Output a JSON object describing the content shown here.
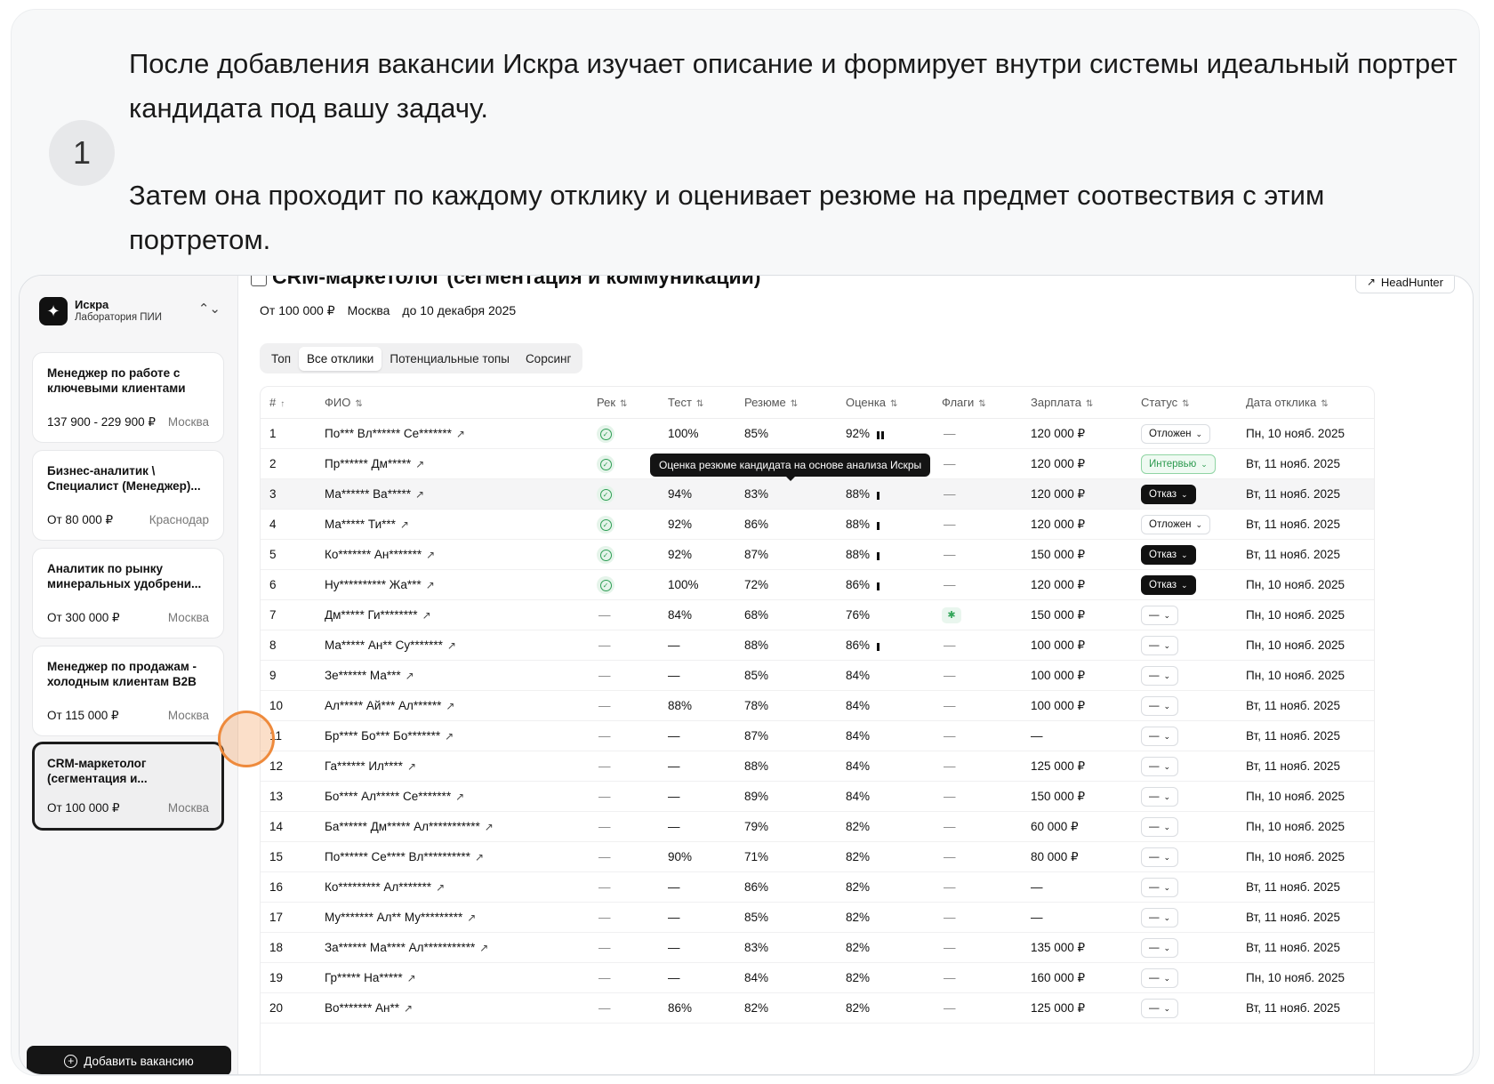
{
  "step": {
    "number": "1",
    "paragraphs": [
      "После добавления вакансии Искра изучает описание и формирует внутри системы идеальный портрет кандидата под вашу задачу.",
      "Затем она проходит по каждому отклику и оценивает резюме на предмет соотвествия с этим портретом."
    ]
  },
  "sidebar": {
    "org": {
      "name": "Искра",
      "subtitle": "Лаборатория ПИИ",
      "logo_icon": "sparkle-icon",
      "toggle_icon": "chevron-updown-icon"
    },
    "vacancies": [
      {
        "title": "Менеджер по работе с ключевыми клиентами",
        "salary": "137 900 - 229 900 ₽",
        "city": "Москва",
        "active": false
      },
      {
        "title": "Бизнес-аналитик \\ Специалист (Менеджер)...",
        "salary": "От 80 000 ₽",
        "city": "Краснодар",
        "active": false
      },
      {
        "title": "Аналитик по рынку минеральных удобрени...",
        "salary": "От 300 000 ₽",
        "city": "Москва",
        "active": false
      },
      {
        "title": "Менеджер по продажам - холодным клиентам B2B",
        "salary": "От 115 000 ₽",
        "city": "Москва",
        "active": false
      },
      {
        "title": "CRM-маркетолог (сегментация и...",
        "salary": "От 100 000 ₽",
        "city": "Москва",
        "active": true
      }
    ],
    "add_button": "Добавить вакансию"
  },
  "header": {
    "title": "CRM-маркетолог (сегментация и коммуникации)",
    "source_button": "HeadHunter",
    "salary": "От 100 000 ₽",
    "city": "Москва",
    "deadline": "до 10 декабря 2025"
  },
  "tabs": [
    {
      "label": "Топ",
      "active": false
    },
    {
      "label": "Все отклики",
      "active": true
    },
    {
      "label": "Потенциальные топы",
      "active": false
    },
    {
      "label": "Сорсинг",
      "active": false
    }
  ],
  "table": {
    "columns": [
      "#",
      "ФИО",
      "Рек",
      "Тест",
      "Резюме",
      "Оценка",
      "Флаги",
      "Зарплата",
      "Статус",
      "Дата отклика"
    ],
    "rows": [
      {
        "n": "1",
        "name": "По*** Вл****** Се*******",
        "rec": true,
        "test": "100%",
        "resume": "85%",
        "score": "92%",
        "bars": 2,
        "flag": false,
        "salary": "120 000 ₽",
        "status": "Отложен",
        "status_type": "delay",
        "date": "Пн, 10 нояб. 2025"
      },
      {
        "n": "2",
        "name": "Пр****** Дм*****",
        "rec": true,
        "test": "",
        "resume": "",
        "score": "",
        "bars": 0,
        "flag": false,
        "salary": "120 000 ₽",
        "status": "Интервью",
        "status_type": "interview",
        "date": "Вт, 11 нояб. 2025"
      },
      {
        "n": "3",
        "name": "Ма****** Ва*****",
        "rec": true,
        "test": "94%",
        "resume": "83%",
        "score": "88%",
        "bars": 1,
        "flag": false,
        "salary": "120 000 ₽",
        "status": "Отказ",
        "status_type": "reject",
        "date": "Вт, 11 нояб. 2025",
        "highlight": true
      },
      {
        "n": "4",
        "name": "Ма***** Ти***",
        "rec": true,
        "test": "92%",
        "resume": "86%",
        "score": "88%",
        "bars": 1,
        "flag": false,
        "salary": "120 000 ₽",
        "status": "Отложен",
        "status_type": "delay",
        "date": "Вт, 11 нояб. 2025"
      },
      {
        "n": "5",
        "name": "Ко******* Ан*******",
        "rec": true,
        "test": "92%",
        "resume": "87%",
        "score": "88%",
        "bars": 1,
        "flag": false,
        "salary": "150 000 ₽",
        "status": "Отказ",
        "status_type": "reject",
        "date": "Вт, 11 нояб. 2025"
      },
      {
        "n": "6",
        "name": "Ну********** Жа***",
        "rec": true,
        "test": "100%",
        "resume": "72%",
        "score": "86%",
        "bars": 1,
        "flag": false,
        "salary": "120 000 ₽",
        "status": "Отказ",
        "status_type": "reject",
        "date": "Пн, 10 нояб. 2025"
      },
      {
        "n": "7",
        "name": "Дм***** Ги********",
        "rec": false,
        "test": "84%",
        "resume": "68%",
        "score": "76%",
        "bars": 0,
        "flag": true,
        "salary": "150 000 ₽",
        "status": "—",
        "status_type": "none",
        "date": "Пн, 10 нояб. 2025"
      },
      {
        "n": "8",
        "name": "Ма***** Ан** Су*******",
        "rec": false,
        "test": "—",
        "resume": "88%",
        "score": "86%",
        "bars": 1,
        "flag": false,
        "salary": "100 000 ₽",
        "status": "—",
        "status_type": "none",
        "date": "Пн, 10 нояб. 2025"
      },
      {
        "n": "9",
        "name": "Зе****** Ма***",
        "rec": false,
        "test": "—",
        "resume": "85%",
        "score": "84%",
        "bars": 0,
        "flag": false,
        "salary": "100 000 ₽",
        "status": "—",
        "status_type": "none",
        "date": "Пн, 10 нояб. 2025"
      },
      {
        "n": "10",
        "name": "Ал***** Ай*** Ал******",
        "rec": false,
        "test": "88%",
        "resume": "78%",
        "score": "84%",
        "bars": 0,
        "flag": false,
        "salary": "100 000 ₽",
        "status": "—",
        "status_type": "none",
        "date": "Вт, 11 нояб. 2025"
      },
      {
        "n": "11",
        "name": "Бр**** Бо*** Бо*******",
        "rec": false,
        "test": "—",
        "resume": "87%",
        "score": "84%",
        "bars": 0,
        "flag": false,
        "salary": "—",
        "status": "—",
        "status_type": "none",
        "date": "Вт, 11 нояб. 2025"
      },
      {
        "n": "12",
        "name": "Га****** Ил****",
        "rec": false,
        "test": "—",
        "resume": "88%",
        "score": "84%",
        "bars": 0,
        "flag": false,
        "salary": "125 000 ₽",
        "status": "—",
        "status_type": "none",
        "date": "Вт, 11 нояб. 2025"
      },
      {
        "n": "13",
        "name": "Бо**** Ал***** Се*******",
        "rec": false,
        "test": "—",
        "resume": "89%",
        "score": "84%",
        "bars": 0,
        "flag": false,
        "salary": "150 000 ₽",
        "status": "—",
        "status_type": "none",
        "date": "Пн, 10 нояб. 2025"
      },
      {
        "n": "14",
        "name": "Ба****** Дм***** Ал***********",
        "rec": false,
        "test": "—",
        "resume": "79%",
        "score": "82%",
        "bars": 0,
        "flag": false,
        "salary": "60 000 ₽",
        "status": "—",
        "status_type": "none",
        "date": "Пн, 10 нояб. 2025"
      },
      {
        "n": "15",
        "name": "По****** Се**** Вл**********",
        "rec": false,
        "test": "90%",
        "resume": "71%",
        "score": "82%",
        "bars": 0,
        "flag": false,
        "salary": "80 000 ₽",
        "status": "—",
        "status_type": "none",
        "date": "Пн, 10 нояб. 2025"
      },
      {
        "n": "16",
        "name": "Ко********* Ал*******",
        "rec": false,
        "test": "—",
        "resume": "86%",
        "score": "82%",
        "bars": 0,
        "flag": false,
        "salary": "—",
        "status": "—",
        "status_type": "none",
        "date": "Вт, 11 нояб. 2025"
      },
      {
        "n": "17",
        "name": "Му******* Ал** Му*********",
        "rec": false,
        "test": "—",
        "resume": "85%",
        "score": "82%",
        "bars": 0,
        "flag": false,
        "salary": "—",
        "status": "—",
        "status_type": "none",
        "date": "Вт, 11 нояб. 2025"
      },
      {
        "n": "18",
        "name": "За****** Ма**** Ал***********",
        "rec": false,
        "test": "—",
        "resume": "83%",
        "score": "82%",
        "bars": 0,
        "flag": false,
        "salary": "135 000 ₽",
        "status": "—",
        "status_type": "none",
        "date": "Вт, 11 нояб. 2025"
      },
      {
        "n": "19",
        "name": "Гр***** На*****",
        "rec": false,
        "test": "—",
        "resume": "84%",
        "score": "82%",
        "bars": 0,
        "flag": false,
        "salary": "160 000 ₽",
        "status": "—",
        "status_type": "none",
        "date": "Пн, 10 нояб. 2025"
      },
      {
        "n": "20",
        "name": "Во******* Ан**",
        "rec": false,
        "test": "86%",
        "resume": "82%",
        "score": "82%",
        "bars": 0,
        "flag": false,
        "salary": "125 000 ₽",
        "status": "—",
        "status_type": "none",
        "date": "Вт, 11 нояб. 2025"
      }
    ],
    "tooltip": "Оценка резюме кандидата на основе анализа Искры"
  },
  "colors": {
    "accent": "#111111",
    "interview": "#2c9a4f",
    "cursor_ring": "#ee8a3c"
  }
}
